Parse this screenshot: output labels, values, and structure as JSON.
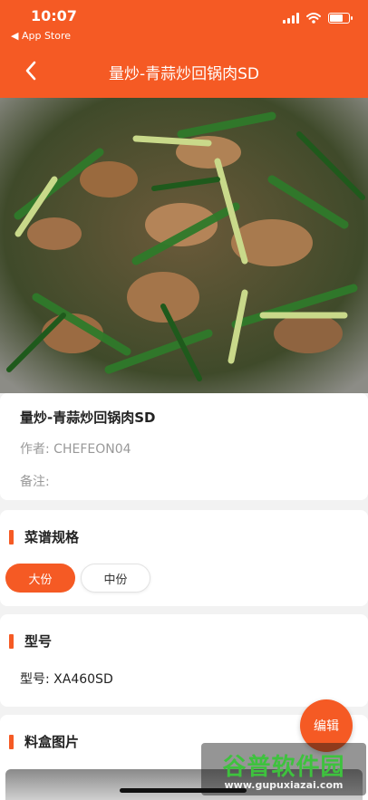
{
  "status": {
    "time": "10:07",
    "back_app": "◀ App Store",
    "battery_level": 0.7
  },
  "nav": {
    "title": "量炒-青蒜炒回锅肉SD",
    "back_icon": "chevron-left-icon"
  },
  "dish": {
    "name": "量炒-青蒜炒回锅肉SD",
    "author": "作者: CHEFEON04",
    "note": "备注:"
  },
  "spec": {
    "title": "菜谱规格",
    "options": [
      {
        "label": "大份",
        "selected": true
      },
      {
        "label": "中份",
        "selected": false
      }
    ]
  },
  "model": {
    "title": "型号",
    "value": "型号: XA460SD"
  },
  "box_images": {
    "title": "料盒图片"
  },
  "actions": {
    "edit_label": "编辑"
  },
  "watermark": {
    "title": "谷普软件园",
    "url": "www.gupuxiazai.com"
  },
  "colors": {
    "accent": "#f55a24",
    "watermark_green": "#3ec23e"
  }
}
